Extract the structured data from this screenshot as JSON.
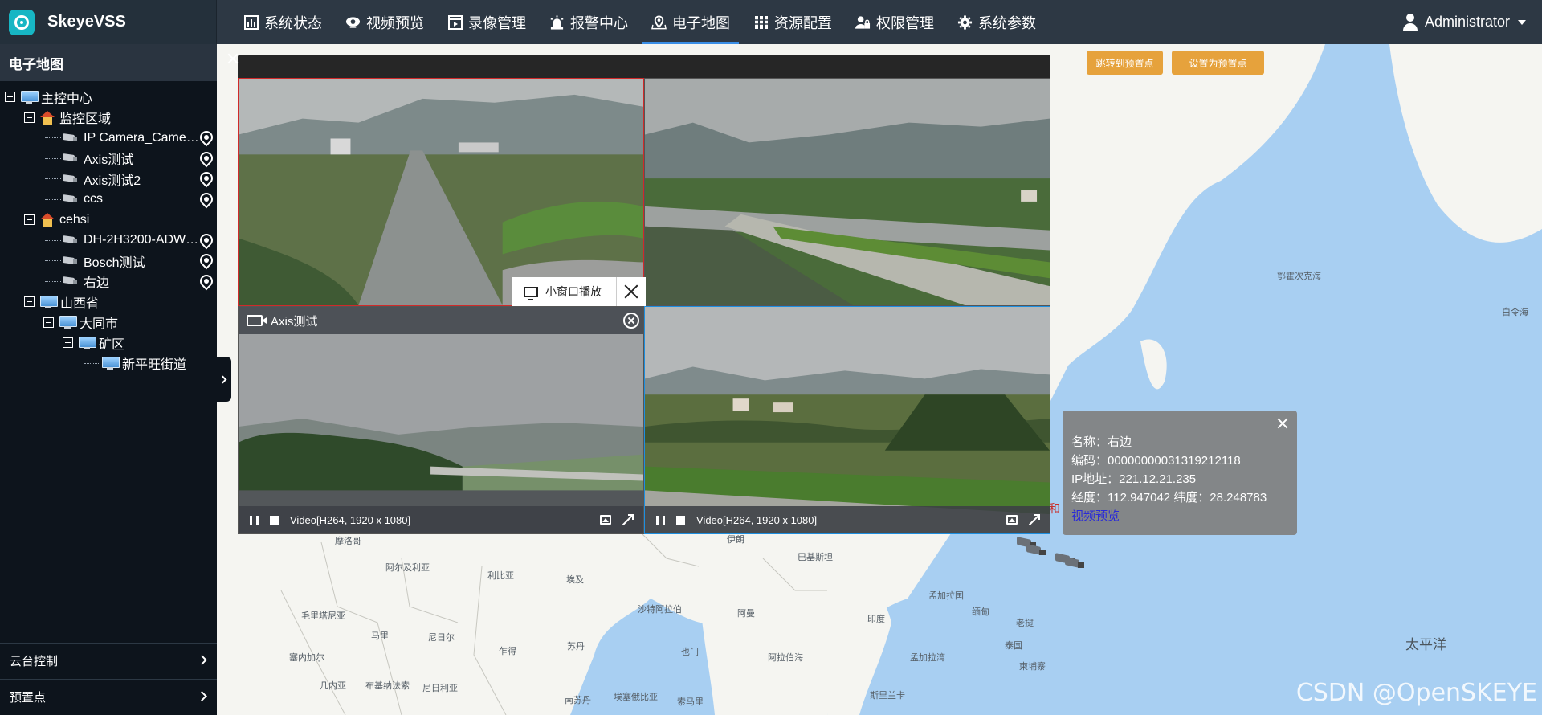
{
  "app": {
    "name": "SkeyeVSS"
  },
  "nav": {
    "items": [
      {
        "label": "系统状态",
        "icon": "chart-bar-icon"
      },
      {
        "label": "视频预览",
        "icon": "camera-icon"
      },
      {
        "label": "录像管理",
        "icon": "film-icon"
      },
      {
        "label": "报警中心",
        "icon": "alarm-light-icon"
      },
      {
        "label": "电子地图",
        "icon": "map-pin-icon",
        "active": true
      },
      {
        "label": "资源配置",
        "icon": "server-icon"
      },
      {
        "label": "权限管理",
        "icon": "user-lock-icon"
      },
      {
        "label": "系统参数",
        "icon": "gear-icon"
      }
    ],
    "user": "Administrator"
  },
  "sidebar": {
    "title": "电子地图",
    "tree": [
      {
        "label": "主控中心",
        "type": "monitor"
      },
      {
        "label": "监控区域",
        "type": "house"
      },
      {
        "label": "IP Camera_Came…",
        "type": "camera"
      },
      {
        "label": "Axis测试",
        "type": "camera"
      },
      {
        "label": "Axis测试2",
        "type": "camera"
      },
      {
        "label": "ccs",
        "type": "camera"
      },
      {
        "label": "cehsi",
        "type": "house"
      },
      {
        "label": "DH-2H3200-ADW…",
        "type": "camera"
      },
      {
        "label": "Bosch测试",
        "type": "camera"
      },
      {
        "label": "右边",
        "type": "camera"
      },
      {
        "label": "山西省",
        "type": "monitor"
      },
      {
        "label": "大同市",
        "type": "monitor"
      },
      {
        "label": "矿区",
        "type": "monitor"
      },
      {
        "label": "新平旺街道",
        "type": "monitor"
      }
    ],
    "footer": {
      "ptz": "云台控制",
      "preset": "预置点"
    }
  },
  "map": {
    "buttons": {
      "goto_preset": "跳转到预置点",
      "set_preset": "设置为预置点"
    },
    "labels": {
      "okhotsk": "鄂霍次克海",
      "pacific": "太平洋",
      "magadan": "白令海",
      "morocco": "摩洛哥",
      "algeria": "阿尔及利亚",
      "libya": "利比亚",
      "egypt": "埃及",
      "saudi": "沙特阿拉伯",
      "iran": "伊朗",
      "pakistan": "巴基斯坦",
      "india": "印度",
      "bangladesh": "孟加拉国",
      "myanmar": "缅甸",
      "thailand": "泰国",
      "laos": "老挝",
      "cambodia": "柬埔寨",
      "mauritania": "毛里塔尼亚",
      "mali": "马里",
      "niger": "尼日尔",
      "chad": "乍得",
      "sudan": "苏丹",
      "yemen": "也门",
      "oman": "阿曼",
      "arabian_sea": "阿拉伯海",
      "bay_bengal": "孟加拉湾",
      "senegal": "塞内加尔",
      "nigeria": "尼日利亚",
      "south_sudan": "南苏丹",
      "ethiopia": "埃塞俄比亚",
      "somalia": "索马里",
      "burkina": "布基纳法索",
      "cameroon": "几内亚",
      "sri_lanka": "斯里兰卡",
      "china_partial": "和"
    },
    "watermark": "CSDN @OpenSKEYE"
  },
  "video_window": {
    "panes": [
      {
        "title": "",
        "codec": ""
      },
      {
        "title": "",
        "codec": ""
      },
      {
        "title": "Axis测试",
        "codec": "Video[H264, 1920 x 1080]"
      },
      {
        "title": "",
        "codec": "Video[H264, 1920 x 1080]"
      }
    ],
    "mini_window_label": "小窗口播放"
  },
  "info_popup": {
    "name": "名称：右边",
    "code": "编码：00000000031319212118",
    "ip": "IP地址：221.12.21.235",
    "coords": "经度：112.947042  纬度：28.248783",
    "link": "视频预览"
  },
  "colors": {
    "topbar": "#2d3844",
    "sidebar": "#0d141c",
    "accent_tab": "#3a8ee6",
    "map_water": "#a8cff2",
    "map_land": "#f4f4f0",
    "preset_button": "#e6a23c"
  }
}
